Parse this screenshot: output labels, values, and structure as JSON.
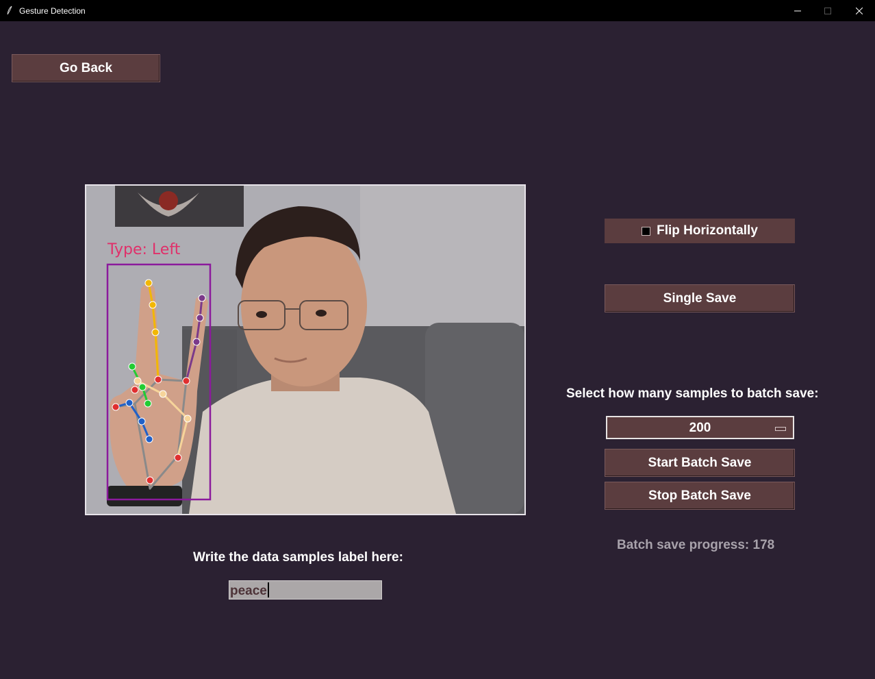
{
  "window": {
    "title": "Gesture Detection"
  },
  "buttons": {
    "go_back": "Go Back",
    "flip": "Flip Horizontally",
    "single_save": "Single Save",
    "start_batch": "Start Batch Save",
    "stop_batch": "Stop Batch Save"
  },
  "flip_checked": false,
  "batch": {
    "label": "Select how many samples to batch save:",
    "selected": "200",
    "progress": "Batch save progress: 178"
  },
  "samples": {
    "label": "Write the data samples label here:",
    "value": "peace"
  },
  "camera": {
    "hand_type": "Type:  Left",
    "bbox_color": "#8b1a9c",
    "label_color": "#e0306a"
  },
  "colors": {
    "background": "#2b2132",
    "button": "#5b3d3f",
    "text": "#ffffff"
  }
}
